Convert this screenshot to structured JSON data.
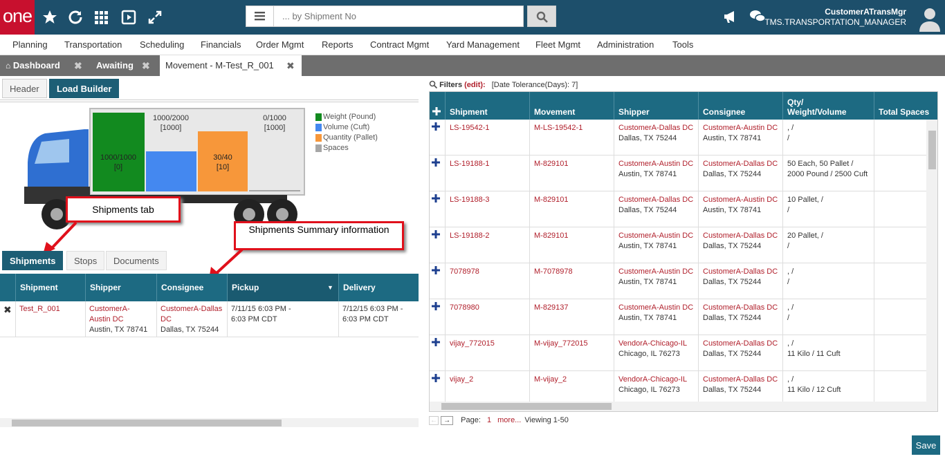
{
  "logo": "one",
  "search": {
    "placeholder": "... by Shipment No"
  },
  "user": {
    "name": "CustomerATransMgr",
    "role": "TMS.TRANSPORTATION_MANAGER"
  },
  "menu": [
    "Planning",
    "Transportation",
    "Scheduling",
    "Financials",
    "Order Mgmt",
    "Reports",
    "Contract Mgmt",
    "Yard Management",
    "Fleet Mgmt",
    "Administration",
    "Tools"
  ],
  "tabs": [
    "Dashboard",
    "Awaiting",
    "Movement - M-Test_R_001"
  ],
  "subtabs": [
    "Header",
    "Load Builder"
  ],
  "truck": {
    "b1_top": "1000/2000",
    "b1_top2": "[1000]",
    "b1_in": "1000/1000",
    "b1_in2": "[0]",
    "b3_in": "30/40",
    "b3_in2": "[10]",
    "b4_top": "0/1000",
    "b4_top2": "[1000]"
  },
  "legend": [
    {
      "label": "Weight (Pound)",
      "color": "#128a1f"
    },
    {
      "label": "Volume (Cuft)",
      "color": "#4488f0"
    },
    {
      "label": "Quantity (Pallet)",
      "color": "#f7973a"
    },
    {
      "label": "Spaces",
      "color": "#a6a6a6"
    }
  ],
  "callouts": {
    "shipments_tab": "Shipments tab",
    "summary": "Shipments Summary information"
  },
  "bottom_tabs": [
    "Shipments",
    "Stops",
    "Documents"
  ],
  "left_grid": {
    "headers": [
      "Shipment",
      "Shipper",
      "Consignee",
      "Pickup",
      "Delivery"
    ],
    "row": {
      "shipment": "Test_R_001",
      "shipper1": "CustomerA-",
      "shipper2": "Austin DC",
      "shipper3": "Austin, TX 78741",
      "cons1": "CustomerA-Dallas",
      "cons2": "DC",
      "cons3": "Dallas, TX 75244",
      "pickup1": "7/11/15 6:03 PM -",
      "pickup2": "6:03 PM CDT",
      "del1": "7/12/15 6:03 PM -",
      "del2": "6:03 PM CDT"
    }
  },
  "filters": {
    "label": "Filters",
    "edit": "(edit):",
    "value": "[Date Tolerance(Days): 7]"
  },
  "right_grid": {
    "headers": [
      "Shipment",
      "Movement",
      "Shipper",
      "Consignee",
      "Qty/\nWeight/Volume",
      "Total Spaces"
    ],
    "rows": [
      {
        "shipment": "LS-19542-1",
        "movement": "M-LS-19542-1",
        "shipper": "CustomerA-Dallas DC",
        "shipper_addr": "Dallas, TX 75244",
        "consignee": "CustomerA-Austin DC",
        "cons_addr": "Austin, TX 78741",
        "qty1": ", /",
        "qty2": "/"
      },
      {
        "shipment": "LS-19188-1",
        "movement": "M-829101",
        "shipper": "CustomerA-Austin DC",
        "shipper_addr": "Austin, TX 78741",
        "consignee": "CustomerA-Dallas DC",
        "cons_addr": "Dallas, TX 75244",
        "qty1": "50 Each, 50 Pallet /",
        "qty2": "2000 Pound / 2500 Cuft"
      },
      {
        "shipment": "LS-19188-3",
        "movement": "M-829101",
        "shipper": "CustomerA-Dallas DC",
        "shipper_addr": "Dallas, TX 75244",
        "consignee": "CustomerA-Austin DC",
        "cons_addr": "Austin, TX 78741",
        "qty1": "10 Pallet, /",
        "qty2": "/"
      },
      {
        "shipment": "LS-19188-2",
        "movement": "M-829101",
        "shipper": "CustomerA-Austin DC",
        "shipper_addr": "Austin, TX 78741",
        "consignee": "CustomerA-Dallas DC",
        "cons_addr": "Dallas, TX 75244",
        "qty1": "20 Pallet, /",
        "qty2": "/"
      },
      {
        "shipment": "7078978",
        "movement": "M-7078978",
        "shipper": "CustomerA-Austin DC",
        "shipper_addr": "Austin, TX 78741",
        "consignee": "CustomerA-Dallas DC",
        "cons_addr": "Dallas, TX 75244",
        "qty1": ", /",
        "qty2": "/"
      },
      {
        "shipment": "7078980",
        "movement": "M-829137",
        "shipper": "CustomerA-Austin DC",
        "shipper_addr": "Austin, TX 78741",
        "consignee": "CustomerA-Dallas DC",
        "cons_addr": "Dallas, TX 75244",
        "qty1": ", /",
        "qty2": "/"
      },
      {
        "shipment": "vijay_772015",
        "movement": "M-vijay_772015",
        "shipper": "VendorA-Chicago-IL",
        "shipper_addr": "Chicago, IL 76273",
        "consignee": "CustomerA-Dallas DC",
        "cons_addr": "Dallas, TX 75244",
        "qty1": ", /",
        "qty2": "11 Kilo / 11 Cuft"
      },
      {
        "shipment": "vijay_2",
        "movement": "M-vijay_2",
        "shipper": "VendorA-Chicago-IL",
        "shipper_addr": "Chicago, IL 76273",
        "consignee": "CustomerA-Dallas DC",
        "cons_addr": "Dallas, TX 75244",
        "qty1": ", /",
        "qty2": "11 Kilo / 12 Cuft"
      }
    ]
  },
  "pager": {
    "label": "Page:",
    "page": "1",
    "more": "more...",
    "viewing": "Viewing 1-50"
  },
  "save_label": "Save"
}
